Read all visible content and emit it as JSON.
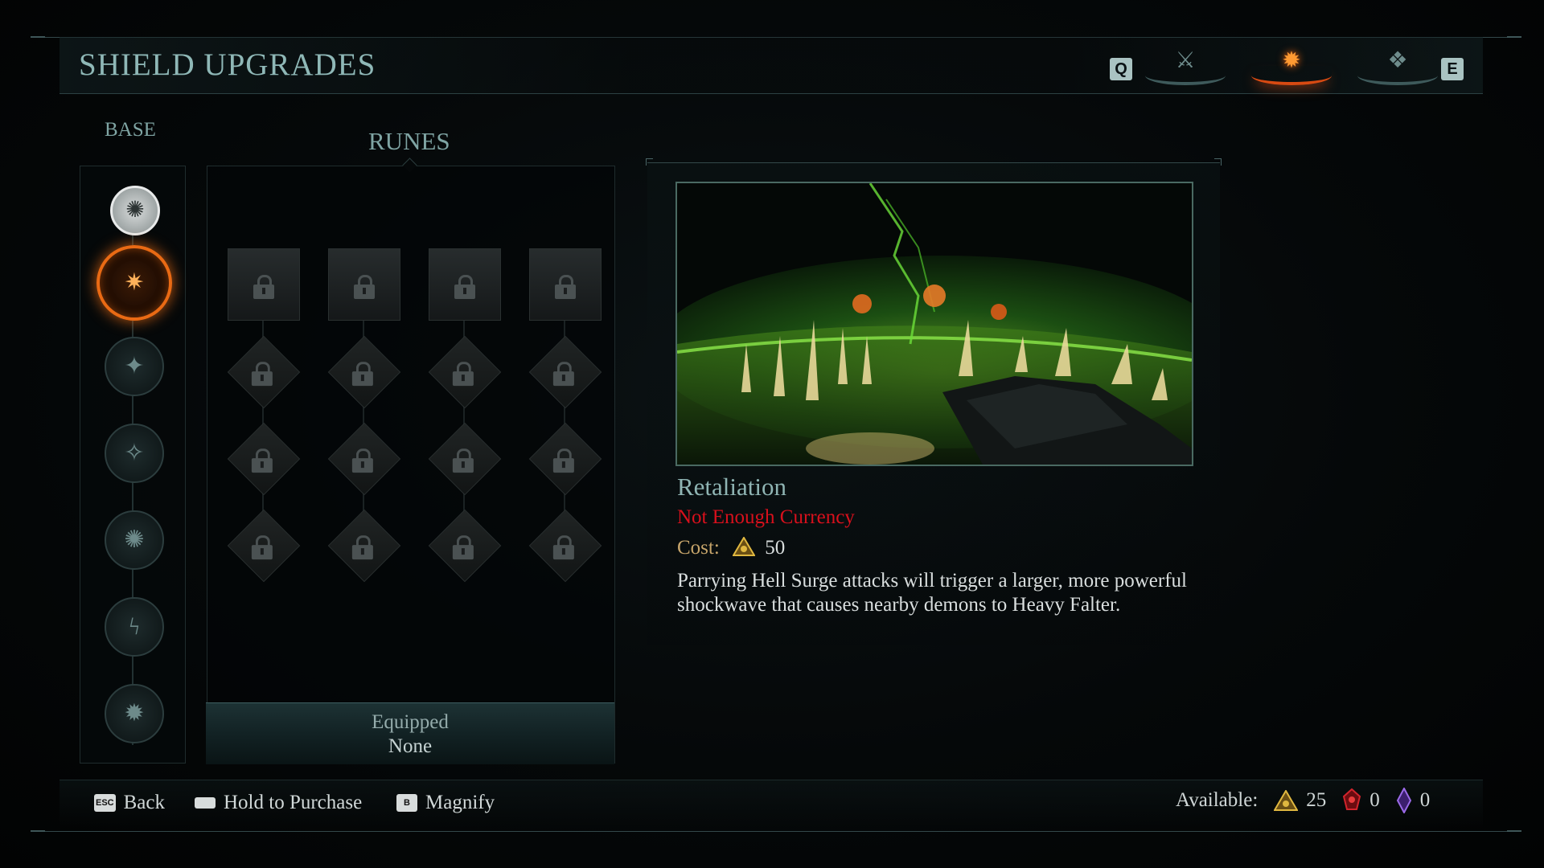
{
  "header": {
    "title": "SHIELD UPGRADES",
    "prev_key": "Q",
    "next_key": "E",
    "tabs": [
      {
        "icon": "crossed-blades-icon",
        "glyph": "⚔",
        "active": false
      },
      {
        "icon": "shield-saw-icon",
        "glyph": "✹",
        "active": true
      },
      {
        "icon": "weapon-icon",
        "glyph": "❖",
        "active": false
      }
    ]
  },
  "base": {
    "label": "BASE",
    "items": [
      {
        "icon": "shield-saw-icon",
        "glyph": "✺"
      },
      {
        "icon": "retaliation-shockwave-icon",
        "glyph": "✷",
        "selected": true
      },
      {
        "icon": "shield-charge-icon",
        "glyph": "✦"
      },
      {
        "icon": "shield-throw-icon",
        "glyph": "✧"
      },
      {
        "icon": "burst-upgrade-icon",
        "glyph": "✺"
      },
      {
        "icon": "lightning-upgrade-icon",
        "glyph": "ϟ"
      },
      {
        "icon": "timer-upgrade-icon",
        "glyph": "✹"
      }
    ]
  },
  "runes": {
    "label": "RUNES",
    "columns": 4,
    "rows": 4,
    "locked": true
  },
  "equipped": {
    "label": "Equipped",
    "value": "None"
  },
  "detail": {
    "title": "Retaliation",
    "status": "Not Enough Currency",
    "cost_label": "Cost:",
    "cost_value": "50",
    "description": "Parrying Hell Surge attacks will trigger a larger, more powerful shockwave that causes nearby demons to Heavy Falter."
  },
  "footer": {
    "hints": [
      {
        "key": "ESC",
        "label": "Back"
      },
      {
        "key": "",
        "label": "Hold to Purchase"
      },
      {
        "key": "B",
        "label": "Magnify"
      }
    ],
    "available_label": "Available:",
    "currencies": [
      {
        "icon": "gold-triangle-currency-icon",
        "value": "25",
        "color": "#d9b23a"
      },
      {
        "icon": "red-gem-currency-icon",
        "value": "0",
        "color": "#d2242c"
      },
      {
        "icon": "purple-crystal-currency-icon",
        "value": "0",
        "color": "#8b5ad6"
      }
    ]
  }
}
